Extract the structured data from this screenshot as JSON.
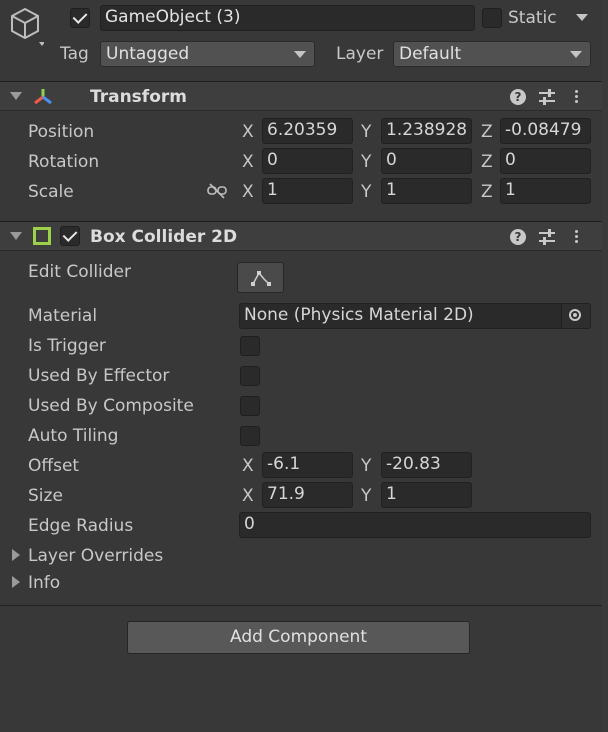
{
  "gameobject": {
    "name": "GameObject (3)",
    "active": true,
    "static_label": "Static",
    "static_checked": false,
    "tag_label": "Tag",
    "tag_value": "Untagged",
    "layer_label": "Layer",
    "layer_value": "Default"
  },
  "transform": {
    "title": "Transform",
    "rows": [
      {
        "label": "Position",
        "x": "6.20359",
        "y": "1.238928",
        "z": "-0.08479"
      },
      {
        "label": "Rotation",
        "x": "0",
        "y": "0",
        "z": "0"
      },
      {
        "label": "Scale",
        "x": "1",
        "y": "1",
        "z": "1"
      }
    ],
    "axis_x": "X",
    "axis_y": "Y",
    "axis_z": "Z"
  },
  "box_collider": {
    "title": "Box Collider 2D",
    "enabled": true,
    "edit_collider_label": "Edit Collider",
    "material_label": "Material",
    "material_value": "None (Physics Material 2D)",
    "is_trigger_label": "Is Trigger",
    "used_by_effector_label": "Used By Effector",
    "used_by_composite_label": "Used By Composite",
    "auto_tiling_label": "Auto Tiling",
    "offset_label": "Offset",
    "offset_x": "-6.1",
    "offset_y": "-20.83",
    "size_label": "Size",
    "size_x": "71.9",
    "size_y": "1",
    "edge_radius_label": "Edge Radius",
    "edge_radius_value": "0",
    "layer_overrides_label": "Layer Overrides",
    "info_label": "Info",
    "accent_color": "#9bd24a"
  },
  "add_component_label": "Add Component",
  "icons": [
    "gameobject-cube-icon",
    "transform-axes-icon",
    "help-icon",
    "presets-icon",
    "kebab-menu-icon",
    "unlink-scale-icon",
    "edit-collider-icon",
    "object-picker-icon"
  ]
}
